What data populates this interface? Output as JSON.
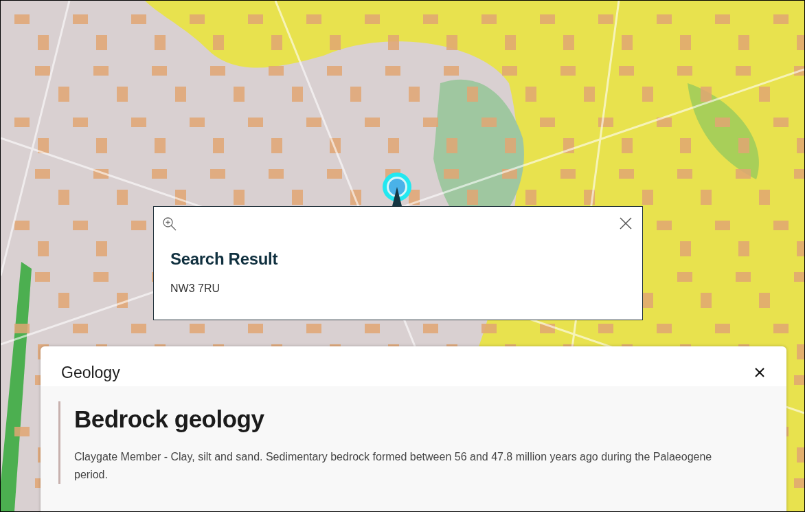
{
  "popup": {
    "title": "Search Result",
    "text": "NW3 7RU"
  },
  "panel": {
    "title": "Geology",
    "section": {
      "heading": "Bedrock geology",
      "text": "Claygate Member - Clay, silt and sand. Sedimentary bedrock formed between 56 and 47.8 million years ago during the Palaeogene period."
    }
  }
}
